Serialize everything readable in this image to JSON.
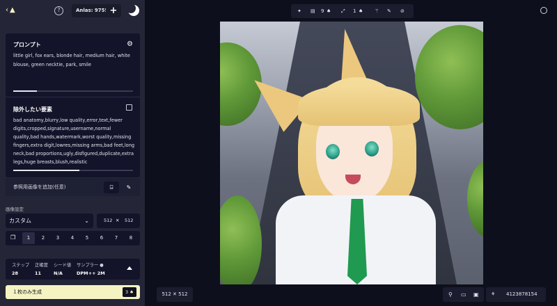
{
  "header": {
    "anlas_label": "Anlas: 9755",
    "anlas_icon": "anlas-coin-icon",
    "plus_label": "+"
  },
  "prompt": {
    "title": "プロンプト",
    "text": "little girl, fox ears, blonde hair, medium hair, white blouse, green necktie, park, smile",
    "progress": 0.2
  },
  "negative": {
    "title": "除外したい要素",
    "text": "bad anatomy,blurry,low quality,error,text,fewer digits,cropped,signature,username,normal quality,bad hands,watermark,worst quality,missing fingers,extra digit,lowres,missing arms,bad feet,long neck,bad proportions,ugly,disfigured,duplicate,extra legs,huge breasts,blush,realistic",
    "progress": 0.55
  },
  "reference": {
    "label": "参照用画像を追加(任意)"
  },
  "image_settings": {
    "section_label": "画像設定",
    "preset": "カスタム",
    "width": "512",
    "height": "512",
    "times": "✕",
    "counts": [
      "1",
      "2",
      "3",
      "4",
      "5",
      "6",
      "7",
      "8"
    ],
    "selected_count": "1"
  },
  "params": {
    "steps_label": "ステップ",
    "steps_value": "28",
    "scale_label": "正確度",
    "scale_value": "11",
    "seed_label": "シード値",
    "seed_value": "N/A",
    "sampler_label": "サンプラー ●",
    "sampler_value": "DPM++ 2M"
  },
  "generate": {
    "label": "１枚のみ生成",
    "cost": "3"
  },
  "toolbar": {
    "count_a": "9",
    "count_b": "1"
  },
  "canvas_footer": {
    "size_label": "512 ✕ 512",
    "seed_value": "4123878154"
  }
}
